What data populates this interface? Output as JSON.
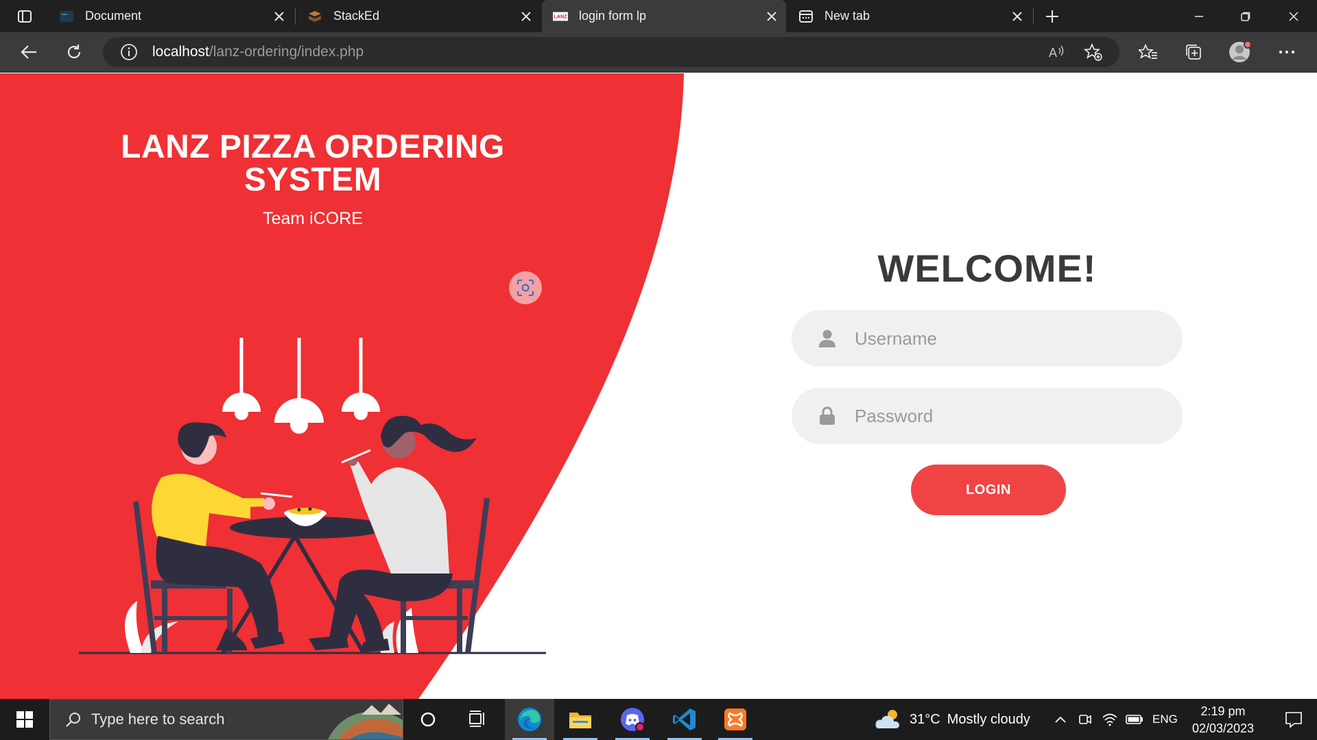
{
  "browser": {
    "tabs": [
      {
        "title": "Document",
        "icon": "document-favicon",
        "active": false
      },
      {
        "title": "StackEd",
        "icon": "stacked-favicon",
        "active": false
      },
      {
        "title": "login form lp",
        "icon": "lanz-favicon",
        "active": true
      },
      {
        "title": "New tab",
        "icon": "new-tab-favicon",
        "active": false
      }
    ],
    "address": {
      "host": "localhost",
      "path": "/lanz-ordering/index.php"
    }
  },
  "page": {
    "brand_title_line1": "LANZ PIZZA ORDERING",
    "brand_title_line2": "SYSTEM",
    "team": "Team iCORE",
    "welcome": "WELCOME!",
    "username_placeholder": "Username",
    "password_placeholder": "Password",
    "login_label": "LOGIN",
    "colors": {
      "brand_red": "#ef3034",
      "button_red": "#f04444",
      "field_bg": "#f0f0f0",
      "heading": "#3a3a3a"
    }
  },
  "taskbar": {
    "search_placeholder": "Type here to search",
    "apps": [
      "task-view-icon",
      "cortana-icon",
      "edge-icon",
      "file-explorer-icon",
      "discord-icon",
      "vscode-icon",
      "xampp-icon"
    ],
    "weather_temp": "31°C",
    "weather_text": "Mostly cloudy",
    "language": "ENG",
    "time": "2:19 pm",
    "date": "02/03/2023"
  }
}
